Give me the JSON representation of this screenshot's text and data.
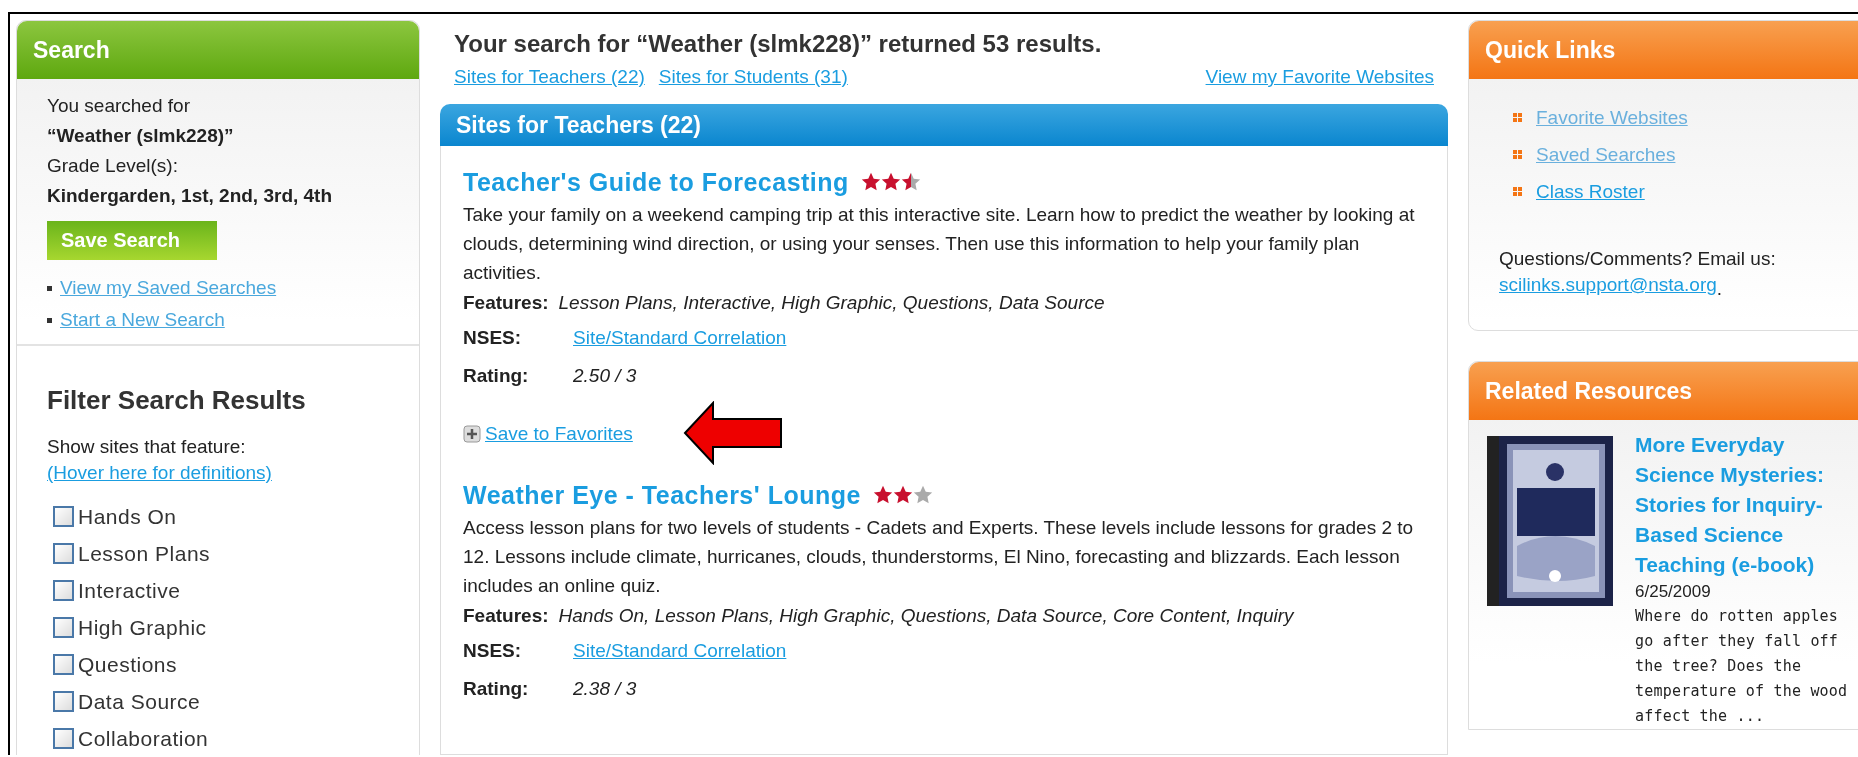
{
  "search_panel": {
    "title": "Search",
    "searched_label": "You searched for",
    "query": "“Weather (slmk228)”",
    "grade_label": "Grade Level(s):",
    "grades": "Kindergarden, 1st, 2nd, 3rd, 4th",
    "save_button": "Save Search",
    "links": [
      "View my Saved Searches",
      "Start a New Search"
    ]
  },
  "filter_panel": {
    "title": "Filter Search Results",
    "intro": "Show sites that feature:",
    "hover_link": "(Hover here for definitions)",
    "options": [
      {
        "label": "Hands On",
        "checked": false
      },
      {
        "label": "Lesson Plans",
        "checked": false
      },
      {
        "label": "Interactive",
        "checked": false
      },
      {
        "label": "High Graphic",
        "checked": false
      },
      {
        "label": "Questions",
        "checked": false
      },
      {
        "label": "Data Source",
        "checked": false
      },
      {
        "label": "Collaboration",
        "checked": false
      }
    ]
  },
  "results": {
    "heading": "Your search for “Weather (slmk228)” returned 53 results.",
    "tabs": [
      "Sites for Teachers (22)",
      "Sites for Students (31)"
    ],
    "favorites_link": "View my Favorite Websites",
    "section_title": "Sites for Teachers (22)",
    "sites": [
      {
        "title": "Teacher's Guide to Forecasting",
        "stars": 2.5,
        "description": "Take your family on a weekend camping trip at this interactive site. Learn how to predict the weather by looking at clouds, determining wind direction, or using your senses. Then use this information to help your family plan activities.",
        "features_label": "Features:",
        "features": "Lesson Plans, Interactive, High Graphic, Questions, Data Source",
        "nses_label": "NSES:",
        "nses_link": "Site/Standard Correlation",
        "rating_label": "Rating:",
        "rating": "2.50 / 3",
        "save_link": "Save to Favorites"
      },
      {
        "title": "Weather Eye - Teachers' Lounge",
        "stars": 2,
        "description": "Access lesson plans for two levels of students - Cadets and Experts. These levels include lessons for grades 2 to 12. Lessons include climate, hurricanes, clouds, thunderstorms, El Nino, forecasting and blizzards. Each lesson includes an online quiz.",
        "features_label": "Features:",
        "features": "Hands On, Lesson Plans, High Graphic, Questions, Data Source, Core Content, Inquiry",
        "nses_label": "NSES:",
        "nses_link": "Site/Standard Correlation",
        "rating_label": "Rating:",
        "rating": "2.38 / 3"
      }
    ]
  },
  "quick_links": {
    "title": "Quick Links",
    "links": [
      "Favorite Websites",
      "Saved Searches",
      "Class Roster"
    ],
    "contact_text": "Questions/Comments? Email us:",
    "email": "scilinks.support@nsta.org",
    "email_end": "."
  },
  "related_resources": {
    "title": "Related Resources",
    "items": [
      {
        "kind": "picture",
        "title": "More Everyday Science Mysteries: Stories for Inquiry-Based Science Teaching (e-book)",
        "date": "6/25/2009",
        "description": "Where do rotten apples go after they fall off the tree? Does the temperature of the wood affect the ..."
      }
    ]
  }
}
